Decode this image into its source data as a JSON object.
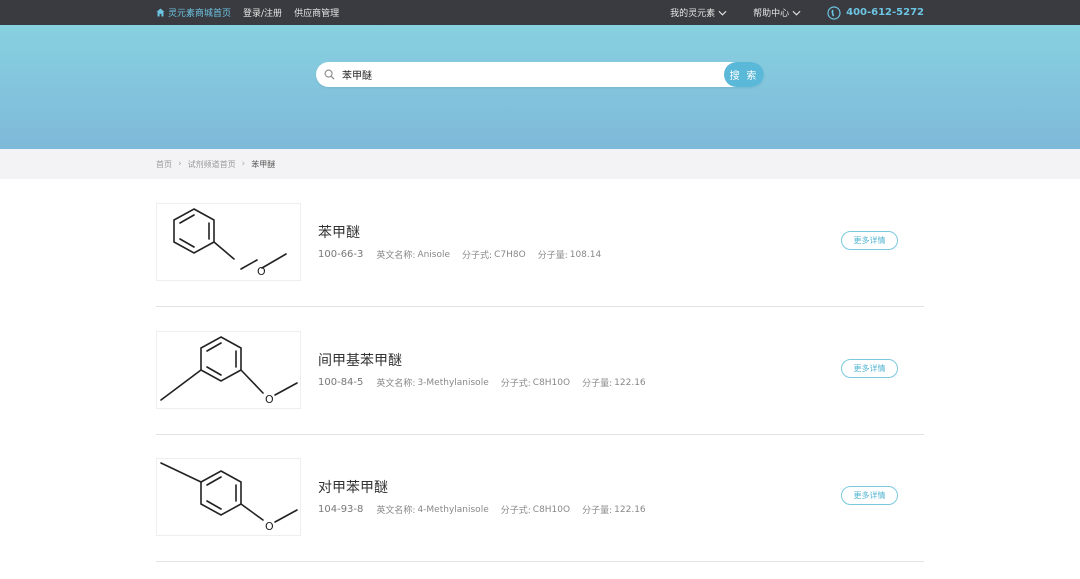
{
  "topbar": {
    "home_link": "灵元素商城首页",
    "login_link": "登录/注册",
    "supplier_link": "供应商管理",
    "my_menu": "我的灵元素",
    "help_menu": "帮助中心",
    "phone": "400-612-5272"
  },
  "search": {
    "value": "苯甲醚",
    "button_label": "搜 索"
  },
  "breadcrumb": {
    "items": [
      "首页",
      "试剂频道首页",
      "苯甲醚"
    ]
  },
  "products": [
    {
      "name": "苯甲醚",
      "cas": "100-66-3",
      "en_label": "英文名称:",
      "en_name": "Anisole",
      "formula_label": "分子式:",
      "formula": "C7H8O",
      "mw_label": "分子量:",
      "mw": "108.14",
      "detail_label": "更多详情",
      "structure_atom": "O"
    },
    {
      "name": "间甲基苯甲醚",
      "cas": "100-84-5",
      "en_label": "英文名称:",
      "en_name": "3-Methylanisole",
      "formula_label": "分子式:",
      "formula": "C8H10O",
      "mw_label": "分子量:",
      "mw": "122.16",
      "detail_label": "更多详情",
      "structure_atom": "O"
    },
    {
      "name": "对甲苯甲醚",
      "cas": "104-93-8",
      "en_label": "英文名称:",
      "en_name": "4-Methylanisole",
      "formula_label": "分子式:",
      "formula": "C8H10O",
      "mw_label": "分子量:",
      "mw": "122.16",
      "detail_label": "更多详情",
      "structure_atom": "O"
    }
  ],
  "colors": {
    "topbar_bg": "#3a3b40",
    "accent": "#5ab8d8",
    "banner_top": "#87d1e0",
    "banner_bottom": "#7fb9d9"
  },
  "icons": {
    "home": "home-icon",
    "search": "search-icon",
    "phone": "phone-icon",
    "chevron": "chevron-down-icon"
  }
}
